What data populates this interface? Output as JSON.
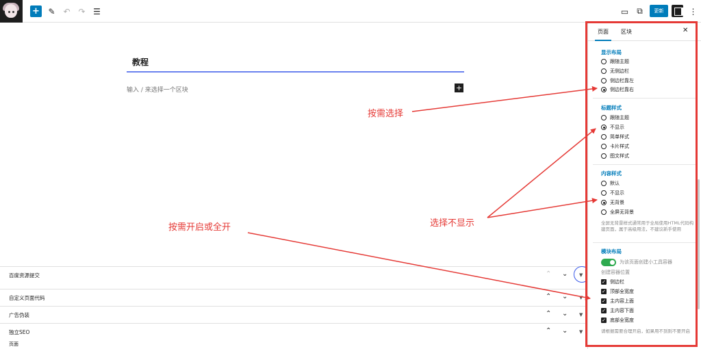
{
  "toolbar": {
    "update_label": "更新"
  },
  "editor": {
    "title": "教程",
    "placeholder": "输入 / 来选择一个区块"
  },
  "meta_boxes": [
    {
      "label": "百度资源提交"
    },
    {
      "label": "自定义页面代码"
    },
    {
      "label": "广告伪装"
    },
    {
      "label": "独立SEO"
    }
  ],
  "footer_crumb": "页面",
  "sidebar": {
    "tabs": [
      "页面",
      "区块"
    ],
    "sections": {
      "layout": {
        "title": "显示布局",
        "options": [
          "跟随主题",
          "无侧边栏",
          "侧边栏靠左",
          "侧边栏靠右"
        ],
        "selected": "侧边栏靠右"
      },
      "title_style": {
        "title": "标题样式",
        "options": [
          "跟随主题",
          "不显示",
          "简单样式",
          "卡片样式",
          "图文样式"
        ],
        "selected": "不显示"
      },
      "content_style": {
        "title": "内容样式",
        "options": [
          "默认",
          "不显示",
          "无背景",
          "全屏无背景"
        ],
        "selected": "无背景",
        "help": "全屏无背景样式通常用于全局使用HTML代码构建页面，属于高级用法，不建议新手使用"
      },
      "module_layout": {
        "title": "模块布局",
        "toggle_label": "为该页面创建小工具容器",
        "toggle_on": true,
        "position_label": "创建容器位置",
        "positions": [
          "侧边栏",
          "顶部全宽度",
          "主内容上面",
          "主内容下面",
          "底部全宽度"
        ],
        "help": "请根据需要合理开启，如果用不到则不要开启"
      }
    }
  },
  "annotations": {
    "select_as_needed": "按需选择",
    "select_hide": "选择不显示",
    "enable_or_all": "按需开启或全开",
    "accent_color": "#e53935"
  },
  "colors": {
    "primary": "#007cba",
    "toggle_on": "#2eaa4f"
  }
}
